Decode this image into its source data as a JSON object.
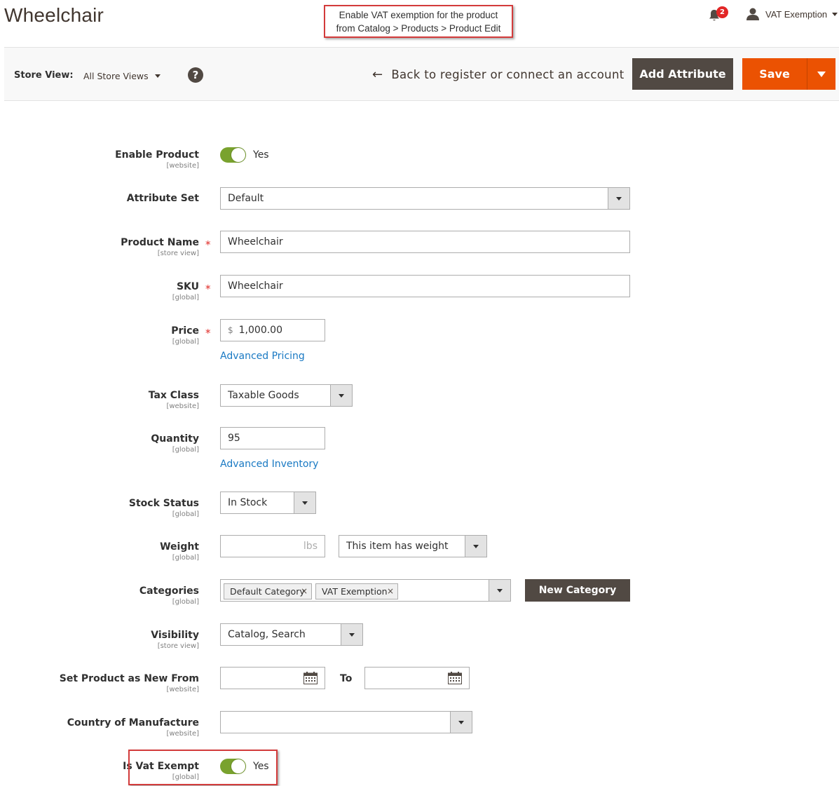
{
  "header": {
    "title": "Wheelchair",
    "callout_line1": "Enable VAT exemption for the product",
    "callout_line2": "from Catalog > Products > Product Edit",
    "notification_count": "2",
    "user_name": "VAT Exemption"
  },
  "toolbar": {
    "store_view_label": "Store View:",
    "store_view_value": "All Store Views",
    "help_glyph": "?",
    "back_label": "Back to register or connect an account",
    "add_attribute_label": "Add Attribute",
    "save_label": "Save"
  },
  "form": {
    "enable_product": {
      "label": "Enable Product",
      "scope": "[website]",
      "value": "Yes",
      "on": true
    },
    "attribute_set": {
      "label": "Attribute Set",
      "value": "Default"
    },
    "product_name": {
      "label": "Product Name",
      "scope": "[store view]",
      "value": "Wheelchair",
      "required": "*"
    },
    "sku": {
      "label": "SKU",
      "scope": "[global]",
      "value": "Wheelchair",
      "required": "*"
    },
    "price": {
      "label": "Price",
      "scope": "[global]",
      "currency": "$",
      "value": "1,000.00",
      "required": "*",
      "link": "Advanced Pricing"
    },
    "tax_class": {
      "label": "Tax Class",
      "scope": "[website]",
      "value": "Taxable Goods"
    },
    "quantity": {
      "label": "Quantity",
      "scope": "[global]",
      "value": "95",
      "link": "Advanced Inventory"
    },
    "stock_status": {
      "label": "Stock Status",
      "scope": "[global]",
      "value": "In Stock"
    },
    "weight": {
      "label": "Weight",
      "scope": "[global]",
      "unit": "lbs",
      "value": "",
      "type_value": "This item has weight"
    },
    "categories": {
      "label": "Categories",
      "scope": "[global]",
      "tags": [
        "Default Category",
        "VAT Exemption"
      ],
      "remove_glyph": "×",
      "new_category_label": "New Category"
    },
    "visibility": {
      "label": "Visibility",
      "scope": "[store view]",
      "value": "Catalog, Search"
    },
    "new_from": {
      "label": "Set Product as New From",
      "scope": "[website]",
      "to_label": "To",
      "from_value": "",
      "to_value": ""
    },
    "country": {
      "label": "Country of Manufacture",
      "scope": "[website]",
      "value": ""
    },
    "vat_exempt": {
      "label": "Is Vat Exempt",
      "scope": "[global]",
      "value": "Yes",
      "on": true
    }
  },
  "colors": {
    "accent_orange": "#eb5202",
    "dark_button": "#514943",
    "toggle_on": "#79a22e",
    "link_blue": "#1979c3",
    "highlight_red": "#d33b3b"
  }
}
